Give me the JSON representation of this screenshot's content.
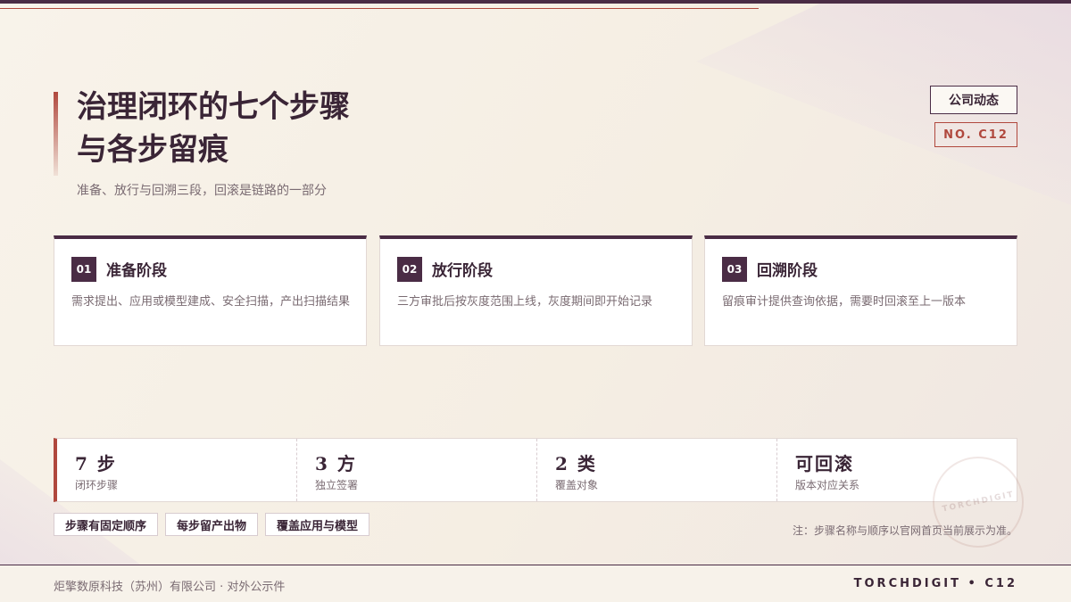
{
  "header": {
    "title_line1": "治理闭环的七个步骤",
    "title_line2": "与各步留痕",
    "subtitle": "准备、放行与回溯三段，回滚是链路的一部分",
    "tag": "公司动态",
    "number": "NO. C12"
  },
  "cards": [
    {
      "num": "01",
      "title": "准备阶段",
      "desc": "需求提出、应用或模型建成、安全扫描，产出扫描结果"
    },
    {
      "num": "02",
      "title": "放行阶段",
      "desc": "三方审批后按灰度范围上线，灰度期间即开始记录"
    },
    {
      "num": "03",
      "title": "回溯阶段",
      "desc": "留痕审计提供查询依据，需要时回滚至上一版本"
    }
  ],
  "stats": [
    {
      "big": "7 步",
      "small": "闭环步骤"
    },
    {
      "big": "3 方",
      "small": "独立签署"
    },
    {
      "big": "2 类",
      "small": "覆盖对象"
    },
    {
      "big": "可回滚",
      "small": "版本对应关系"
    }
  ],
  "chips": [
    "步骤有固定顺序",
    "每步留产出物",
    "覆盖应用与模型"
  ],
  "note": "注：步骤名称与顺序以官网首页当前展示为准。",
  "stamp": "TORCHDIGIT",
  "footer": {
    "left": "炬擎数原科技（苏州）有限公司 · 对外公示件",
    "right": "TORCHDIGIT • C12"
  },
  "colors": {
    "primary": "#4a2c45",
    "accent": "#b0483d",
    "background": "#f6f0e6"
  }
}
